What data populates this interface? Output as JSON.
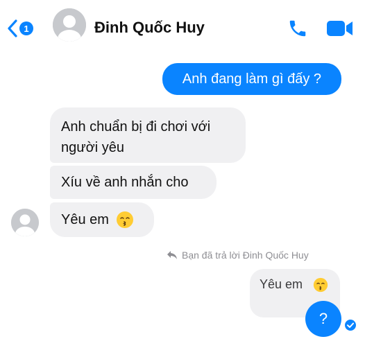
{
  "header": {
    "back_count": "1",
    "contact_name": "Đinh Quốc Huy"
  },
  "messages": [
    {
      "id": "m1",
      "direction": "outgoing",
      "text": "Anh đang làm gì đấy ?"
    },
    {
      "id": "m2",
      "direction": "incoming",
      "text": "Anh chuẩn bị đi chơi với người yêu"
    },
    {
      "id": "m3",
      "direction": "incoming",
      "text": "Xíu về anh nhắn cho"
    },
    {
      "id": "m4",
      "direction": "incoming",
      "text": "Yêu em",
      "emoji": "kissing-face-icon"
    }
  ],
  "reply_note": "Bạn đã trả lời Đinh Quốc Huy",
  "quoted_message": {
    "text": "Yêu em",
    "emoji": "kissing-face-icon"
  },
  "reply_message": {
    "text": "?"
  },
  "colors": {
    "accent": "#0a84ff",
    "incoming_bubble": "#f0f0f2",
    "muted_text": "#8e8e93"
  },
  "icons": [
    "chevron-left-icon",
    "phone-icon",
    "video-camera-icon",
    "reply-arrow-icon",
    "seen-check-icon",
    "default-avatar-icon"
  ]
}
